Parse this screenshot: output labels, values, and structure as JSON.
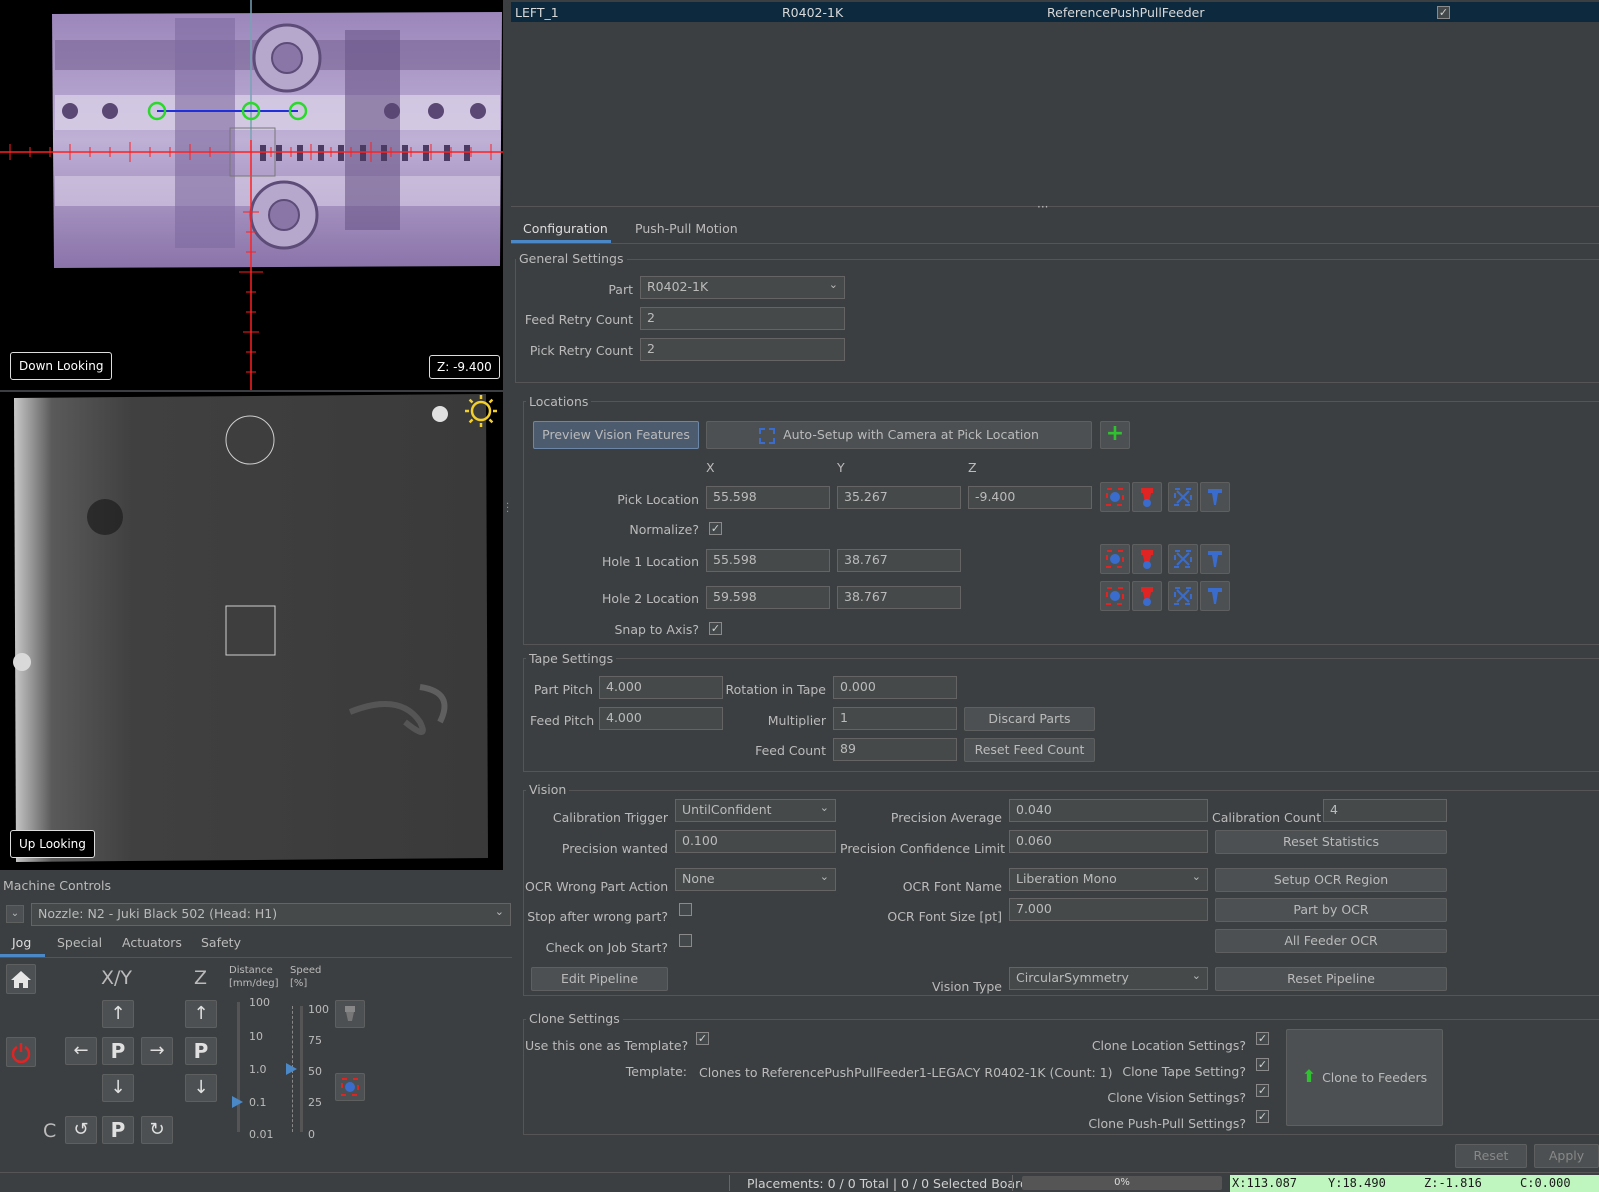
{
  "camera_top": {
    "label": "Down Looking",
    "z_badge": "Z: -9.400"
  },
  "camera_bottom": {
    "label": "Up Looking"
  },
  "feeder_table": {
    "rows": [
      {
        "name": "LEFT_1",
        "part": "R0402-1K",
        "type": "ReferencePushPullFeeder",
        "enabled": true
      }
    ]
  },
  "tabs": {
    "configuration": "Configuration",
    "push_pull": "Push-Pull Motion"
  },
  "general": {
    "title": "General Settings",
    "part_label": "Part",
    "part_value": "R0402-1K",
    "feed_retry_label": "Feed Retry Count",
    "feed_retry_value": "2",
    "pick_retry_label": "Pick Retry Count",
    "pick_retry_value": "2"
  },
  "locations": {
    "title": "Locations",
    "preview_btn": "Preview Vision Features",
    "autosetup_btn": "Auto-Setup with Camera at Pick Location",
    "add_btn": "+",
    "col_x": "X",
    "col_y": "Y",
    "col_z": "Z",
    "pick_label": "Pick Location",
    "pick_x": "55.598",
    "pick_y": "35.267",
    "pick_z": "-9.400",
    "normalize_label": "Normalize?",
    "hole1_label": "Hole 1 Location",
    "hole1_x": "55.598",
    "hole1_y": "38.767",
    "hole2_label": "Hole 2 Location",
    "hole2_x": "59.598",
    "hole2_y": "38.767",
    "snap_label": "Snap to Axis?"
  },
  "tape": {
    "title": "Tape Settings",
    "part_pitch_label": "Part Pitch",
    "part_pitch": "4.000",
    "rotation_label": "Rotation in Tape",
    "rotation": "0.000",
    "feed_pitch_label": "Feed Pitch",
    "feed_pitch": "4.000",
    "multiplier_label": "Multiplier",
    "multiplier": "1",
    "discard_btn": "Discard Parts",
    "feed_count_label": "Feed Count",
    "feed_count": "89",
    "reset_feed_btn": "Reset Feed Count"
  },
  "vision": {
    "title": "Vision",
    "cal_trigger_label": "Calibration Trigger",
    "cal_trigger": "UntilConfident",
    "precision_avg_label": "Precision Average",
    "precision_avg": "0.040",
    "cal_count_label": "Calibration Count",
    "cal_count": "4",
    "precision_wanted_label": "Precision wanted",
    "precision_wanted": "0.100",
    "precision_conf_label": "Precision Confidence Limit",
    "precision_conf": "0.060",
    "reset_stats_btn": "Reset Statistics",
    "ocr_action_label": "OCR Wrong Part Action",
    "ocr_action": "None",
    "ocr_font_label": "OCR Font Name",
    "ocr_font": "Liberation Mono",
    "setup_ocr_btn": "Setup OCR Region",
    "stop_wrong_label": "Stop after wrong part?",
    "ocr_size_label": "OCR Font Size [pt]",
    "ocr_size": "7.000",
    "part_ocr_btn": "Part by OCR",
    "check_job_label": "Check on Job Start?",
    "all_ocr_btn": "All Feeder OCR",
    "edit_pipeline_btn": "Edit Pipeline",
    "vision_type_label": "Vision Type",
    "vision_type": "CircularSymmetry",
    "reset_pipeline_btn": "Reset Pipeline"
  },
  "clone": {
    "title": "Clone Settings",
    "use_template_label": "Use this one as Template?",
    "template_label": "Template:",
    "template_value": "Clones to ReferencePushPullFeeder1-LEGACY R0402-1K (Count: 1)",
    "clone_location_label": "Clone Location Settings?",
    "clone_tape_label": "Clone Tape Setting?",
    "clone_vision_label": "Clone Vision Settings?",
    "clone_pushpull_label": "Clone Push-Pull Settings?",
    "clone_btn": "Clone to Feeders"
  },
  "footer": {
    "reset_btn": "Reset",
    "apply_btn": "Apply"
  },
  "machine": {
    "title": "Machine Controls",
    "nozzle": "Nozzle: N2 - Juki Black 502 (Head: H1)",
    "tabs": [
      "Jog",
      "Special",
      "Actuators",
      "Safety"
    ],
    "xy_label": "X/Y",
    "z_label": "Z",
    "c_label": "C",
    "distance_label": "Distance",
    "distance_unit": "[mm/deg]",
    "speed_label": "Speed",
    "speed_unit": "[%]",
    "distance_ticks": [
      "100",
      "10",
      "1.0",
      "0.1",
      "0.01"
    ],
    "speed_ticks": [
      "100",
      "75",
      "50",
      "25",
      "0"
    ],
    "distance_value": "0.1",
    "speed_value": 50
  },
  "status": {
    "placements": "Placements: 0 / 0 Total | 0 / 0 Selected Board",
    "progress": "0%",
    "progress_value": 0,
    "dro_x": "X:113.087",
    "dro_y": "Y:18.490",
    "dro_z": "Z:-1.816",
    "dro_c": "C:0.000"
  },
  "colors": {
    "accent": "#4a88c7",
    "dro_bg": "#bff5bf",
    "selected_row": "#0d293e",
    "crosshair_red": "#ff2020",
    "jog_green": "#2fc12f"
  }
}
